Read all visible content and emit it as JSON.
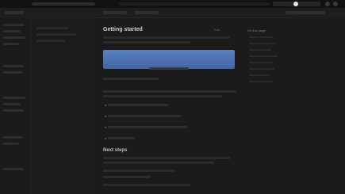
{
  "page": {
    "title": "Getting started",
    "edit_label": "Edit"
  },
  "toc": {
    "title": "On this page"
  },
  "main": {
    "section_heading": "Next steps"
  }
}
